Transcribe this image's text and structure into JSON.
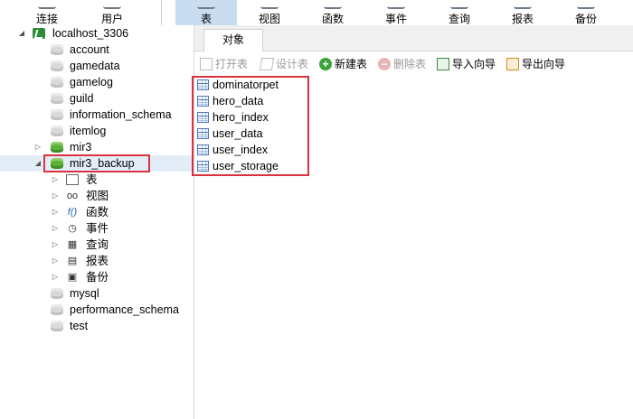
{
  "toolbar": {
    "items": [
      {
        "label": "连接",
        "icon": "connection-icon"
      },
      {
        "label": "用户",
        "icon": "user-icon"
      },
      {
        "label": "表",
        "icon": "table-icon"
      },
      {
        "label": "视图",
        "icon": "view-icon"
      },
      {
        "label": "函数",
        "icon": "function-icon"
      },
      {
        "label": "事件",
        "icon": "event-icon"
      },
      {
        "label": "查询",
        "icon": "query-icon"
      },
      {
        "label": "报表",
        "icon": "report-icon"
      },
      {
        "label": "备份",
        "icon": "backup-icon"
      }
    ],
    "active_index": 2,
    "active_color": "#c9dcf0"
  },
  "tree": {
    "connection": "localhost_3306",
    "databases": [
      {
        "name": "account"
      },
      {
        "name": "gamedata"
      },
      {
        "name": "gamelog"
      },
      {
        "name": "guild"
      },
      {
        "name": "information_schema"
      },
      {
        "name": "itemlog"
      },
      {
        "name": "mir3"
      },
      {
        "name": "mir3_backup"
      },
      {
        "name": "mysql"
      },
      {
        "name": "performance_schema"
      },
      {
        "name": "test"
      }
    ],
    "expanded_db_children": [
      {
        "label": "表",
        "icon": "table-icon"
      },
      {
        "label": "视图",
        "icon": "view-icon"
      },
      {
        "label": "函数",
        "icon": "function-icon"
      },
      {
        "label": "事件",
        "icon": "event-icon"
      },
      {
        "label": "查询",
        "icon": "query-icon"
      },
      {
        "label": "报表",
        "icon": "report-icon"
      },
      {
        "label": "备份",
        "icon": "backup-icon"
      }
    ],
    "selected": "mir3_backup"
  },
  "tabs": {
    "objects": "对象"
  },
  "object_toolbar": {
    "open_table": "打开表",
    "design_table": "设计表",
    "new_table": "新建表",
    "delete_table": "删除表",
    "import_wizard": "导入向导",
    "export_wizard": "导出向导"
  },
  "tables": [
    "dominatorpet",
    "hero_data",
    "hero_index",
    "user_data",
    "user_index",
    "user_storage"
  ],
  "highlight_color": "#d9333f"
}
